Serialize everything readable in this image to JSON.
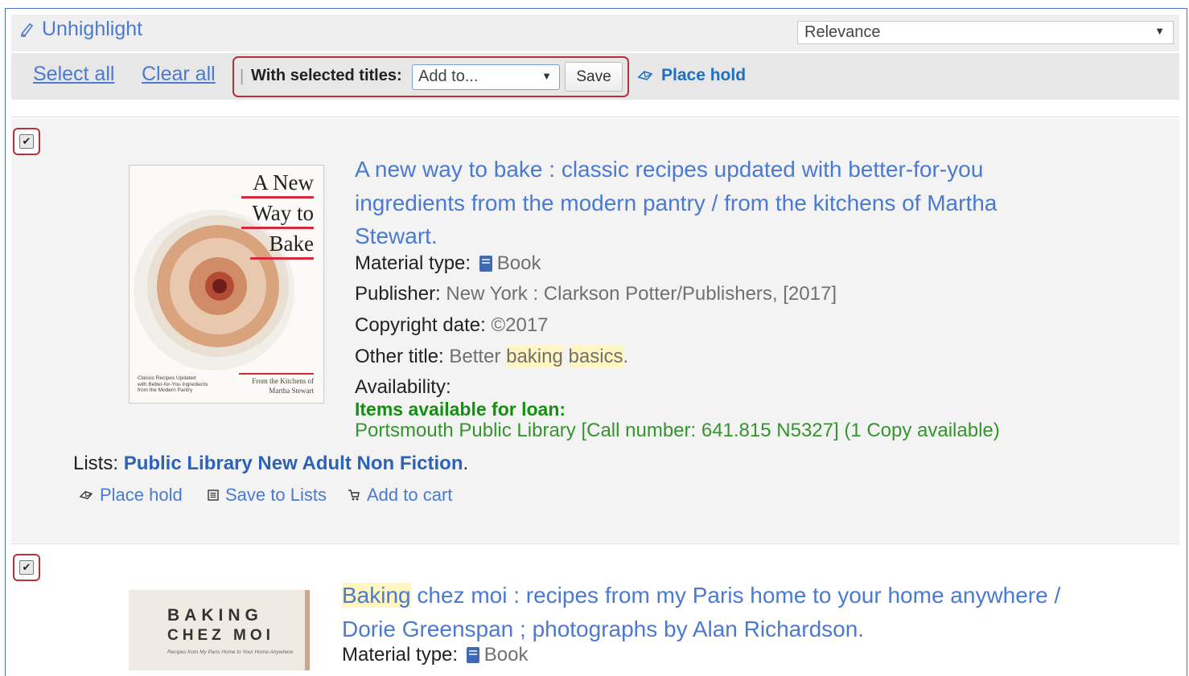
{
  "toolbar": {
    "unhighlight": "Unhighlight",
    "sort_value": "Relevance",
    "select_all": "Select all",
    "clear_all": "Clear all",
    "with_selected": "With selected titles:",
    "add_to": "Add to...",
    "save": "Save",
    "place_hold": "Place hold"
  },
  "records": [
    {
      "checked": true,
      "title_l1": "A new way to bake : classic recipes updated with better-for-you",
      "title_l2": "ingredients from the modern pantry / from the kitchens of Martha",
      "title_l3": "Stewart.",
      "material_label": "Material type:",
      "material_value": "Book",
      "publisher_label": "Publisher:",
      "publisher_value": "New York : Clarkson Potter/Publishers, [2017]",
      "copyright_label": "Copyright date:",
      "copyright_value": "©2017",
      "other_title_label": "Other title:",
      "other_title_1": "Better",
      "other_title_2": "baking",
      "other_title_3": "basics",
      "other_title_4": ".",
      "availability_label": "Availability:",
      "items_available": "Items available for loan:",
      "location": "Portsmouth Public Library [Call number: 641.815 N5327] (1 Copy available)",
      "lists_label": "Lists:",
      "lists_value": "Public Library New Adult Non Fiction",
      "lists_end": ".",
      "action_place_hold": "Place hold",
      "action_save_lists": "Save to Lists",
      "action_add_cart": "Add to cart",
      "cover": {
        "line1": "A New",
        "line2": "Way to",
        "line3": "Bake",
        "blurb_left_1": "Classic Recipes Updated",
        "blurb_left_2": "with Better-for-You Ingredients",
        "blurb_left_3": "from the Modern Pantry",
        "blurb_right_1": "From the Kitchens of",
        "blurb_right_2": "Martha Stewart"
      }
    },
    {
      "checked": true,
      "title_hl": "Baking",
      "title_l1_rest": " chez moi : recipes from my Paris home to your home anywhere /",
      "title_l2": "Dorie Greenspan ; photographs by Alan Richardson.",
      "material_label": "Material type:",
      "material_value": "Book",
      "cover": {
        "line1": "BAKING",
        "line2": "CHEZ MOI",
        "blurb": "Recipes from My Paris Home to Your Home Anywhere"
      }
    }
  ],
  "colors": {
    "link": "#4b7ad0",
    "highlight_box": "#b5323a",
    "available_green": "#13900f",
    "search_term_highlight": "#fff6c2"
  }
}
